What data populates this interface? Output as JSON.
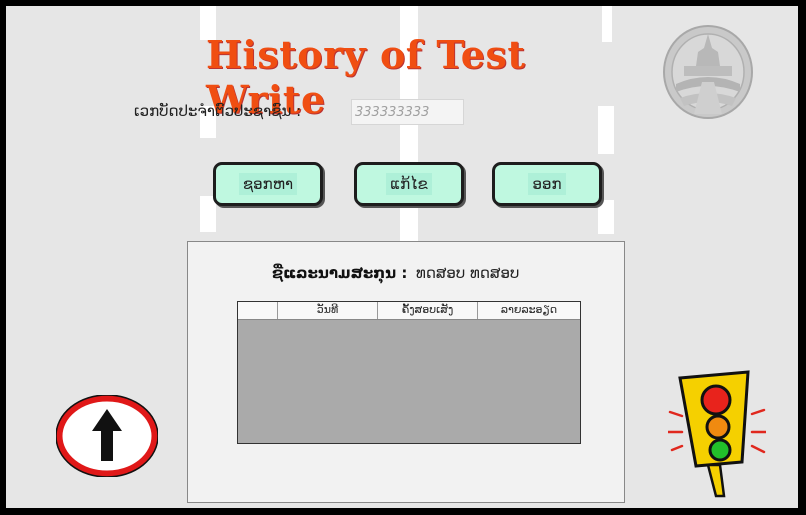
{
  "app": {
    "title": "History of Test Write"
  },
  "id_field": {
    "label": "ເວກບັດປະຈຳຕົວປະຊາຊົນ :",
    "value": "333333333"
  },
  "buttons": {
    "search": "ຊອກຫາ",
    "edit": "ແກ້ໄຂ",
    "exit": "ອອກ"
  },
  "record": {
    "name_label": "ຊື່ແລະນາມສະກຸນ :",
    "name_value": "ທດສອບ ທດສອບ"
  },
  "table": {
    "columns": [
      "ວັນທີ",
      "ຄັ້ງສອບເສັງ",
      "ລາຍລະອຽດ"
    ],
    "rows": []
  },
  "colors": {
    "title": "#f04e12",
    "button_fill": "#bff8e0",
    "panel_bg": "#e6e6e6",
    "grid_bg": "#aaaaaa"
  },
  "icons": [
    "government-seal-icon",
    "no-entry-arrow-sign-icon",
    "traffic-light-icon"
  ]
}
